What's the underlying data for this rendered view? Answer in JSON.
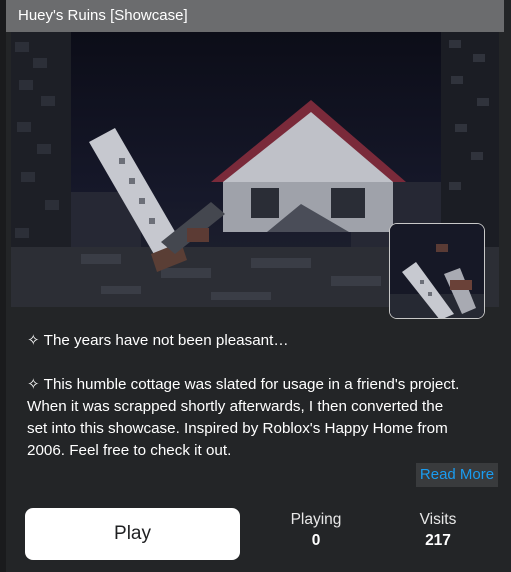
{
  "window": {
    "title": "Huey's Ruins [Showcase]"
  },
  "media": {
    "hero_icon": "game-screenshot-ruined-cottage",
    "thumbnail_icon": "game-thumbnail"
  },
  "description": {
    "paragraphs": [
      "✧ The years have not been pleasant…",
      "✧ This humble cottage was slated for usage in a friend's project. When it was scrapped shortly afterwards, I then converted the set into this showcase. Inspired by Roblox's Happy Home from 2006. Feel free to check it out."
    ],
    "read_more_label": "Read More"
  },
  "actions": {
    "play_label": "Play"
  },
  "stats": {
    "playing_label": "Playing",
    "playing_value": "0",
    "visits_label": "Visits",
    "visits_value": "217"
  },
  "colors": {
    "background": "#232527",
    "title_bar": "#6b6c6e",
    "link": "#1a9cf0",
    "play_button": "#ffffff"
  }
}
